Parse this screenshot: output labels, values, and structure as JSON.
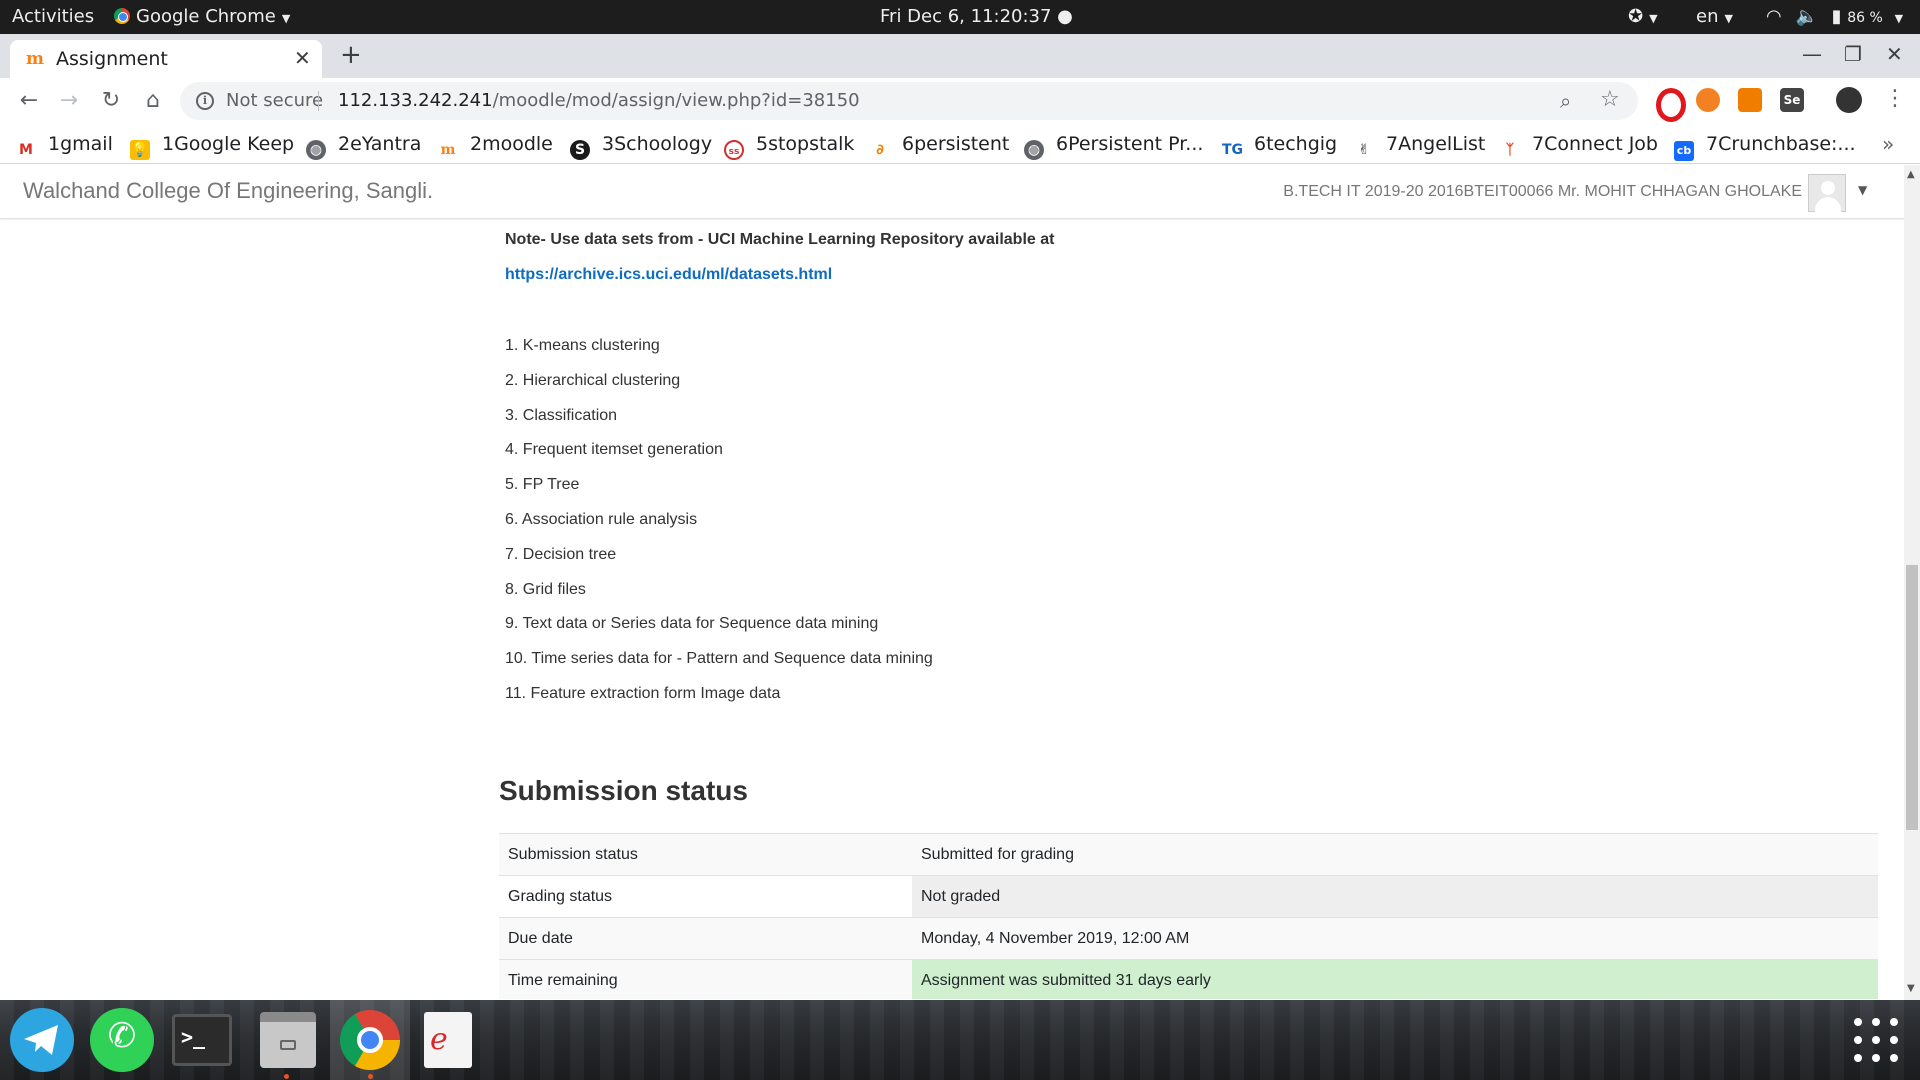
{
  "system_bar": {
    "activities": "Activities",
    "app_name": "Google Chrome",
    "clock": "Fri Dec  6, 11:20:37 ●",
    "language": "en",
    "battery": "86 %"
  },
  "browser": {
    "tab_title": "Assignment",
    "new_tab": "+",
    "not_secure": "Not secure",
    "url_host": "112.133.242.241",
    "url_path": "/moodle/mod/assign/view.php?id=38150",
    "bookmarks": [
      {
        "label": "1gmail",
        "icon": "gmail-icon"
      },
      {
        "label": "1Google Keep",
        "icon": "keep-icon"
      },
      {
        "label": "2eYantra",
        "icon": "globe-icon"
      },
      {
        "label": "2moodle",
        "icon": "moodle-icon"
      },
      {
        "label": "3Schoology",
        "icon": "schoology-icon"
      },
      {
        "label": "5stopstalk",
        "icon": "stopstalk-icon"
      },
      {
        "label": "6persistent",
        "icon": "persistent-icon"
      },
      {
        "label": "6Persistent Pr...",
        "icon": "globe-icon"
      },
      {
        "label": "6techgig",
        "icon": "techgig-icon"
      },
      {
        "label": "7AngelList",
        "icon": "angellist-icon"
      },
      {
        "label": "7Connect Job",
        "icon": "connect-job-icon"
      },
      {
        "label": "7Crunchbase:...",
        "icon": "crunchbase-icon"
      }
    ]
  },
  "moodle": {
    "site_name": "Walchand College Of Engineering, Sangli.",
    "user_name": "B.TECH IT 2019-20 2016BTEIT00066 Mr. MOHIT CHHAGAN GHOLAKE"
  },
  "assignment": {
    "note": "Note- Use data sets from - UCI Machine Learning Repository available at",
    "link": "https://archive.ics.uci.edu/ml/datasets.html",
    "topics": [
      "1. K-means clustering",
      "2. Hierarchical clustering",
      "3. Classification",
      "4. Frequent itemset generation",
      "5. FP Tree",
      "6. Association rule analysis",
      "7. Decision tree",
      "8. Grid files",
      "9. Text data or Series data for Sequence data mining",
      "10. Time series data for - Pattern and Sequence data mining",
      "11. Feature extraction form Image data"
    ]
  },
  "submission": {
    "heading": "Submission status",
    "rows": [
      {
        "label": "Submission status",
        "value": "Submitted for grading"
      },
      {
        "label": "Grading status",
        "value": "Not graded"
      },
      {
        "label": "Due date",
        "value": "Monday, 4 November 2019, 12:00 AM"
      },
      {
        "label": "Time remaining",
        "value": "Assignment was submitted 31 days early"
      }
    ]
  },
  "colors": {
    "link": "#0f6cbf",
    "early_highlight": "#cfefcf",
    "ubuntu_accent": "#e95420"
  }
}
